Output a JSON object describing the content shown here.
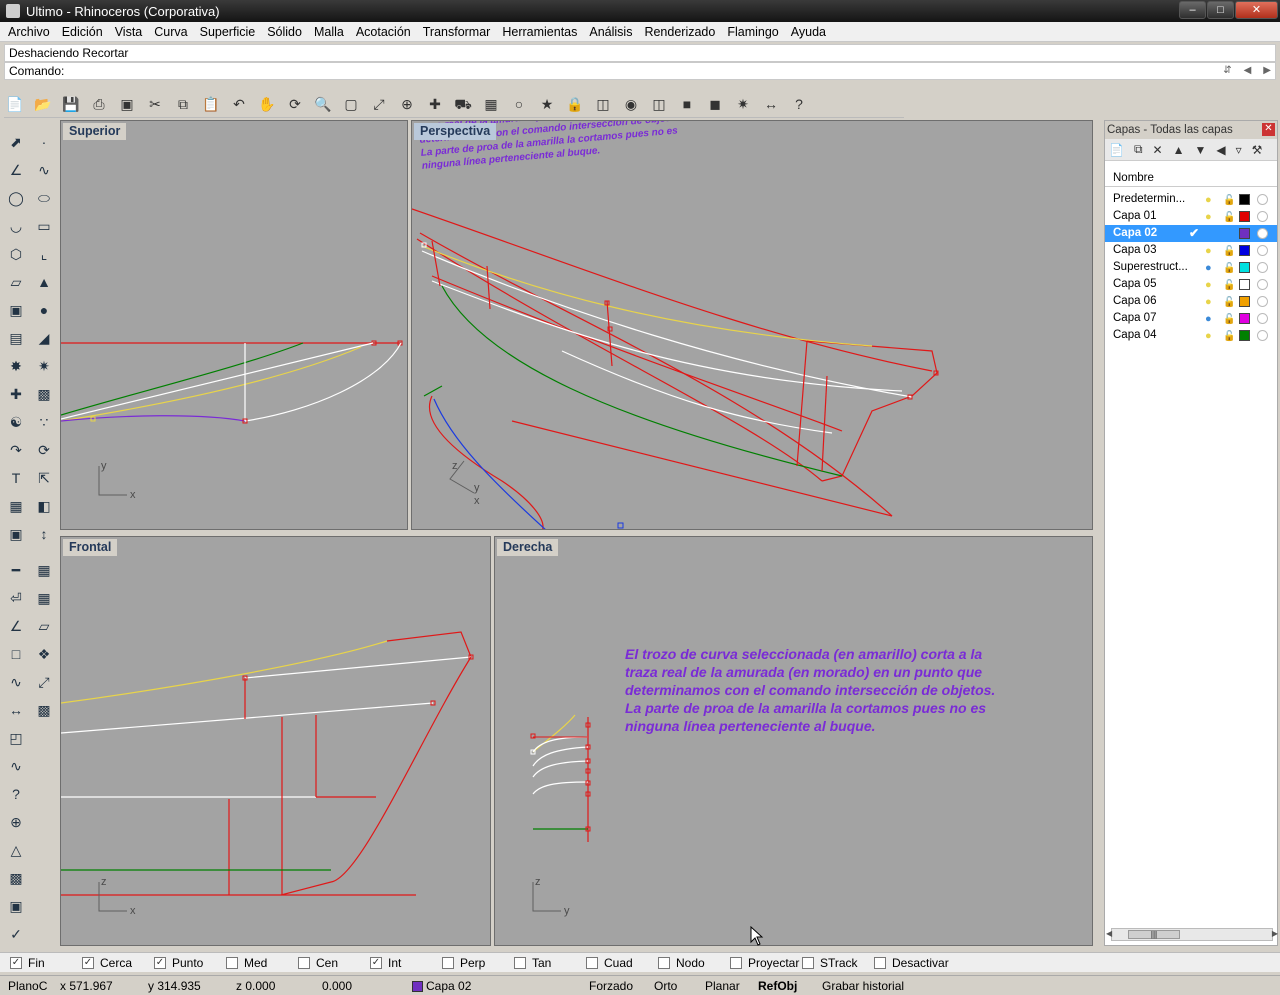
{
  "window": {
    "title": "Ultimo - Rhinoceros (Corporativa)"
  },
  "menu": [
    "Archivo",
    "Edición",
    "Vista",
    "Curva",
    "Superficie",
    "Sólido",
    "Malla",
    "Acotación",
    "Transformar",
    "Herramientas",
    "Análisis",
    "Renderizado",
    "Flamingo",
    "Ayuda"
  ],
  "history_line": "Deshaciendo Recortar",
  "command": {
    "label": "Comando:",
    "value": ""
  },
  "viewports": {
    "top": {
      "title": "Superior",
      "axis_v": "y",
      "axis_h": "x"
    },
    "perspective": {
      "title": "Perspectiva",
      "axis_z": "z",
      "axis_y": "y",
      "axis_x": "x"
    },
    "front": {
      "title": "Frontal",
      "axis_v": "z",
      "axis_h": "x"
    },
    "right": {
      "title": "Derecha",
      "axis_v": "z",
      "axis_h": "y"
    }
  },
  "annotation": {
    "lines": [
      "El trozo de curva seleccionada (en amarillo) corta a la",
      "traza real de la amurada (en morado) en un punto que",
      "determinamos con el comando intersección de objetos.",
      "La parte de proa de la amarilla la cortamos pues no es",
      "ninguna línea perteneciente al buque."
    ],
    "perspective_lines": [
      "traza real de la amurada (en morado) en un",
      "determinamos con el comando intersección de objetos.",
      "La parte de proa de la amarilla la cortamos pues no es",
      "ninguna línea perteneciente al buque."
    ],
    "color": "#7a2bd6"
  },
  "layers_panel": {
    "title": "Capas - Todas las capas",
    "column": "Nombre",
    "layers": [
      {
        "name": "Predetermin...",
        "color": "#000000",
        "selected": false,
        "bulb": "#e8d44a"
      },
      {
        "name": "Capa 01",
        "color": "#e00000",
        "selected": false,
        "bulb": "#e8d44a"
      },
      {
        "name": "Capa 02",
        "color": "#7030c0",
        "selected": true,
        "bulb": ""
      },
      {
        "name": "Capa 03",
        "color": "#0000e0",
        "selected": false,
        "bulb": "#e8d44a"
      },
      {
        "name": "Superestruct...",
        "color": "#00e0e0",
        "selected": false,
        "bulb": "#3b8ad8"
      },
      {
        "name": "Capa 05",
        "color": "#ffffff",
        "selected": false,
        "bulb": "#e8d44a"
      },
      {
        "name": "Capa 06",
        "color": "#f0a000",
        "selected": false,
        "bulb": "#e8d44a"
      },
      {
        "name": "Capa 07",
        "color": "#e000e0",
        "selected": false,
        "bulb": "#3b8ad8"
      },
      {
        "name": "Capa 04",
        "color": "#008000",
        "selected": false,
        "bulb": "#e8d44a"
      }
    ]
  },
  "osnaps": [
    {
      "label": "Fin",
      "checked": true
    },
    {
      "label": "Cerca",
      "checked": true
    },
    {
      "label": "Punto",
      "checked": true
    },
    {
      "label": "Med",
      "checked": false
    },
    {
      "label": "Cen",
      "checked": false
    },
    {
      "label": "Int",
      "checked": true
    },
    {
      "label": "Perp",
      "checked": false
    },
    {
      "label": "Tan",
      "checked": false
    },
    {
      "label": "Cuad",
      "checked": false
    },
    {
      "label": "Nodo",
      "checked": false
    },
    {
      "label": "Proyectar",
      "checked": false
    },
    {
      "label": "STrack",
      "checked": false
    },
    {
      "label": "Desactivar",
      "checked": false
    }
  ],
  "status": {
    "plane": "PlanoC",
    "x": "x 571.967",
    "y": "y 314.935",
    "z": "z 0.000",
    "dist": "0.000",
    "layer": "Capa 02",
    "forzado": "Forzado",
    "orto": "Orto",
    "planar": "Planar",
    "refobj": "RefObj",
    "grabar": "Grabar historial"
  }
}
